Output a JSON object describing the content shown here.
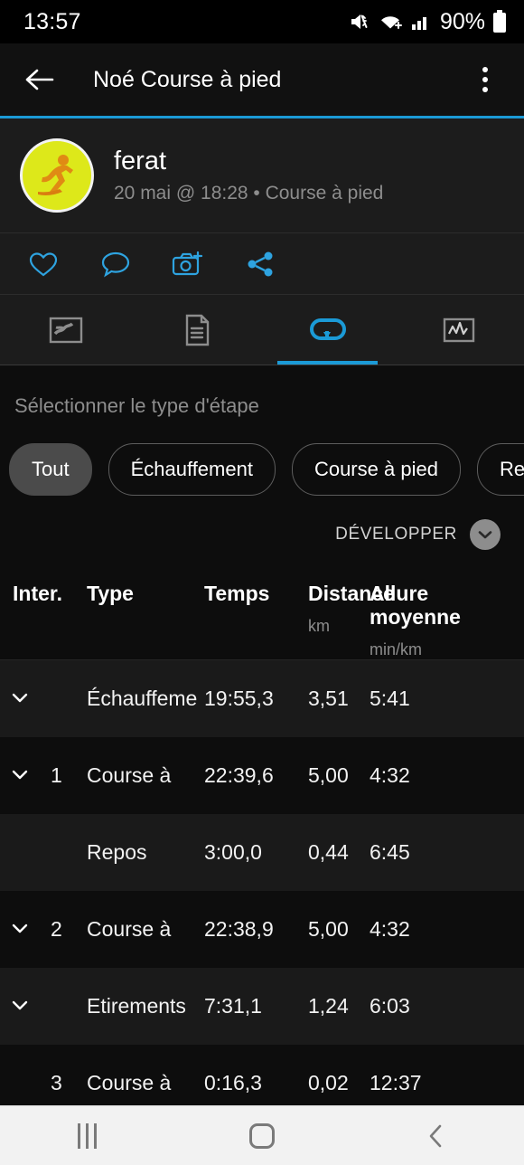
{
  "status_bar": {
    "time": "13:57",
    "battery_pct": "90%",
    "icons": [
      "volume-mute-icon",
      "wifi-icon",
      "cellular-signal-icon",
      "battery-icon"
    ]
  },
  "app_bar": {
    "back_icon": "arrow-left-icon",
    "title": "Noé Course à pied",
    "overflow_icon": "more-vertical-icon",
    "accent_color": "#1b9ad6"
  },
  "profile": {
    "avatar_icon": "running-person-avatar",
    "avatar_bg": "#dde81a",
    "avatar_fg": "#e08a14",
    "name": "ferat",
    "subtitle": "20 mai @ 18:28 • Course à pied"
  },
  "social_actions": [
    {
      "name": "like-button",
      "icon": "heart-icon"
    },
    {
      "name": "comment-button",
      "icon": "comment-bubble-icon"
    },
    {
      "name": "add-photo-button",
      "icon": "camera-plus-icon"
    },
    {
      "name": "share-button",
      "icon": "share-icon"
    }
  ],
  "tabs": [
    {
      "name": "tab-map",
      "icon": "map-icon",
      "active": false
    },
    {
      "name": "tab-details",
      "icon": "document-list-icon",
      "active": false
    },
    {
      "name": "tab-laps",
      "icon": "loop-arrow-icon",
      "active": true
    },
    {
      "name": "tab-charts",
      "icon": "chart-graph-icon",
      "active": false
    }
  ],
  "filter": {
    "label": "Sélectionner le type d'étape",
    "chips": [
      {
        "label": "Tout",
        "selected": true
      },
      {
        "label": "Échauffement",
        "selected": false
      },
      {
        "label": "Course à pied",
        "selected": false
      },
      {
        "label": "Repos",
        "selected": false
      }
    ]
  },
  "expand": {
    "label": "DÉVELOPPER",
    "icon": "chevron-down-icon"
  },
  "table": {
    "headers": {
      "inter": "Inter.",
      "type": "Type",
      "temps": "Temps",
      "distance": "Distance",
      "distance_unit": "km",
      "allure": "Allure moyenne",
      "allure_unit": "min/km"
    },
    "rows": [
      {
        "chevron": true,
        "inter": "",
        "type": "Échauffeme",
        "temps": "19:55,3",
        "distance": "3,51",
        "allure": "5:41"
      },
      {
        "chevron": true,
        "inter": "1",
        "type": "Course à",
        "temps": "22:39,6",
        "distance": "5,00",
        "allure": "4:32"
      },
      {
        "chevron": false,
        "inter": "",
        "type": "Repos",
        "temps": "3:00,0",
        "distance": "0,44",
        "allure": "6:45"
      },
      {
        "chevron": true,
        "inter": "2",
        "type": "Course à",
        "temps": "22:38,9",
        "distance": "5,00",
        "allure": "4:32"
      },
      {
        "chevron": true,
        "inter": "",
        "type": "Etirements",
        "temps": "7:31,1",
        "distance": "1,24",
        "allure": "6:03"
      },
      {
        "chevron": false,
        "inter": "3",
        "type": "Course à",
        "temps": "0:16,3",
        "distance": "0,02",
        "allure": "12:37"
      }
    ]
  },
  "nav_bar": [
    {
      "name": "recents-button",
      "icon": "recents-icon"
    },
    {
      "name": "home-button",
      "icon": "home-icon"
    },
    {
      "name": "back-button",
      "icon": "back-chevron-icon"
    }
  ]
}
